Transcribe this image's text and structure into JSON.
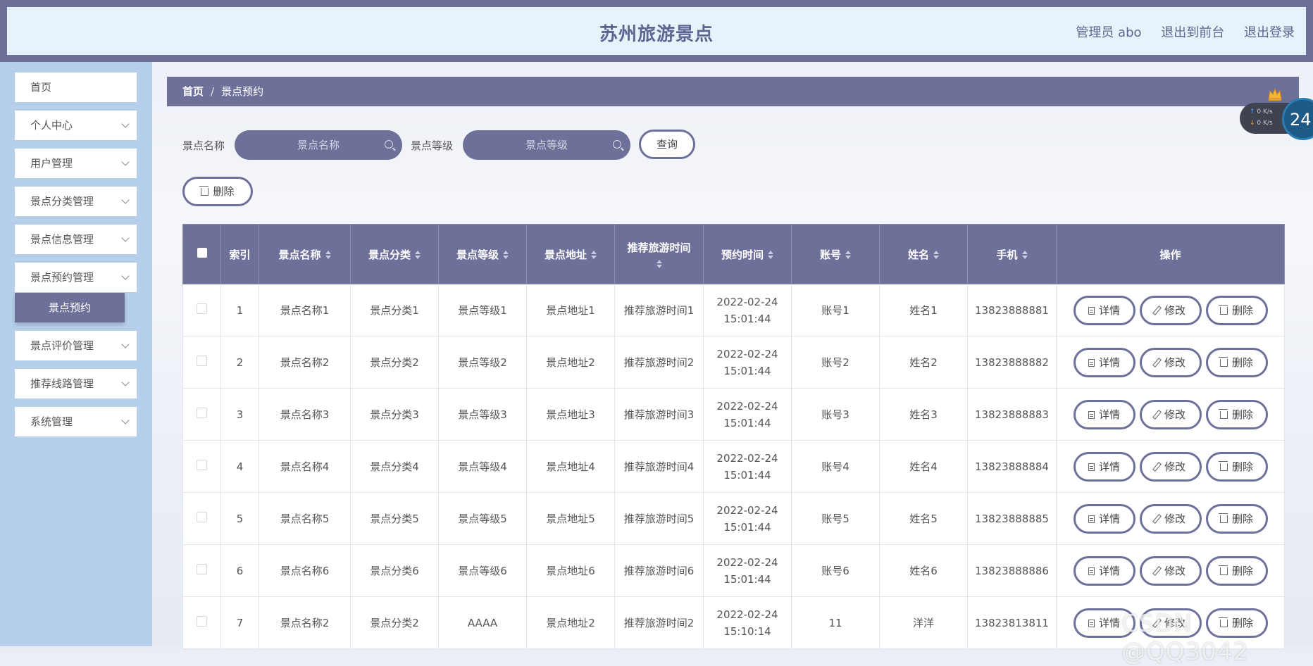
{
  "header": {
    "title": "苏州旅游景点",
    "user": "管理员 abo",
    "to_front": "退出到前台",
    "logout": "退出登录"
  },
  "sidebar": {
    "items": [
      {
        "label": "首页",
        "has_chevron": false
      },
      {
        "label": "个人中心",
        "has_chevron": true
      },
      {
        "label": "用户管理",
        "has_chevron": true
      },
      {
        "label": "景点分类管理",
        "has_chevron": true
      },
      {
        "label": "景点信息管理",
        "has_chevron": true
      },
      {
        "label": "景点预约管理",
        "has_chevron": true
      },
      {
        "label": "景点评价管理",
        "has_chevron": true
      },
      {
        "label": "推荐线路管理",
        "has_chevron": true
      },
      {
        "label": "系统管理",
        "has_chevron": true
      }
    ],
    "active_sub": "景点预约"
  },
  "breadcrumb": {
    "home": "首页",
    "separator": "/",
    "current": "景点预约"
  },
  "search": {
    "name_label": "景点名称",
    "name_placeholder": "景点名称",
    "level_label": "景点等级",
    "level_placeholder": "景点等级",
    "query_button": "查询",
    "delete_button": "删除"
  },
  "table": {
    "headers": {
      "index": "索引",
      "name": "景点名称",
      "category": "景点分类",
      "level": "景点等级",
      "address": "景点地址",
      "recommend_time": "推荐旅游时间",
      "booking_time": "预约时间",
      "account": "账号",
      "person": "姓名",
      "phone": "手机",
      "actions": "操作"
    },
    "action_labels": {
      "detail": "详情",
      "edit": "修改",
      "delete": "删除"
    },
    "rows": [
      {
        "index": "1",
        "name": "景点名称1",
        "category": "景点分类1",
        "level": "景点等级1",
        "address": "景点地址1",
        "recommend_time": "推荐旅游时间1",
        "booking_time": "2022-02-24 15:01:44",
        "account": "账号1",
        "person": "姓名1",
        "phone": "13823888881"
      },
      {
        "index": "2",
        "name": "景点名称2",
        "category": "景点分类2",
        "level": "景点等级2",
        "address": "景点地址2",
        "recommend_time": "推荐旅游时间2",
        "booking_time": "2022-02-24 15:01:44",
        "account": "账号2",
        "person": "姓名2",
        "phone": "13823888882"
      },
      {
        "index": "3",
        "name": "景点名称3",
        "category": "景点分类3",
        "level": "景点等级3",
        "address": "景点地址3",
        "recommend_time": "推荐旅游时间3",
        "booking_time": "2022-02-24 15:01:44",
        "account": "账号3",
        "person": "姓名3",
        "phone": "13823888883"
      },
      {
        "index": "4",
        "name": "景点名称4",
        "category": "景点分类4",
        "level": "景点等级4",
        "address": "景点地址4",
        "recommend_time": "推荐旅游时间4",
        "booking_time": "2022-02-24 15:01:44",
        "account": "账号4",
        "person": "姓名4",
        "phone": "13823888884"
      },
      {
        "index": "5",
        "name": "景点名称5",
        "category": "景点分类5",
        "level": "景点等级5",
        "address": "景点地址5",
        "recommend_time": "推荐旅游时间5",
        "booking_time": "2022-02-24 15:01:44",
        "account": "账号5",
        "person": "姓名5",
        "phone": "13823888885"
      },
      {
        "index": "6",
        "name": "景点名称6",
        "category": "景点分类6",
        "level": "景点等级6",
        "address": "景点地址6",
        "recommend_time": "推荐旅游时间6",
        "booking_time": "2022-02-24 15:01:44",
        "account": "账号6",
        "person": "姓名6",
        "phone": "13823888886"
      },
      {
        "index": "7",
        "name": "景点名称2",
        "category": "景点分类2",
        "level": "AAAA",
        "address": "景点地址2",
        "recommend_time": "推荐旅游时间2",
        "booking_time": "2022-02-24 15:10:14",
        "account": "11",
        "person": "洋洋",
        "phone": "13823813811"
      }
    ]
  },
  "net_widget": {
    "up": "0 K/s",
    "down": "0 K/s",
    "value": "24"
  },
  "watermark": "CSDN @QQ3042"
}
